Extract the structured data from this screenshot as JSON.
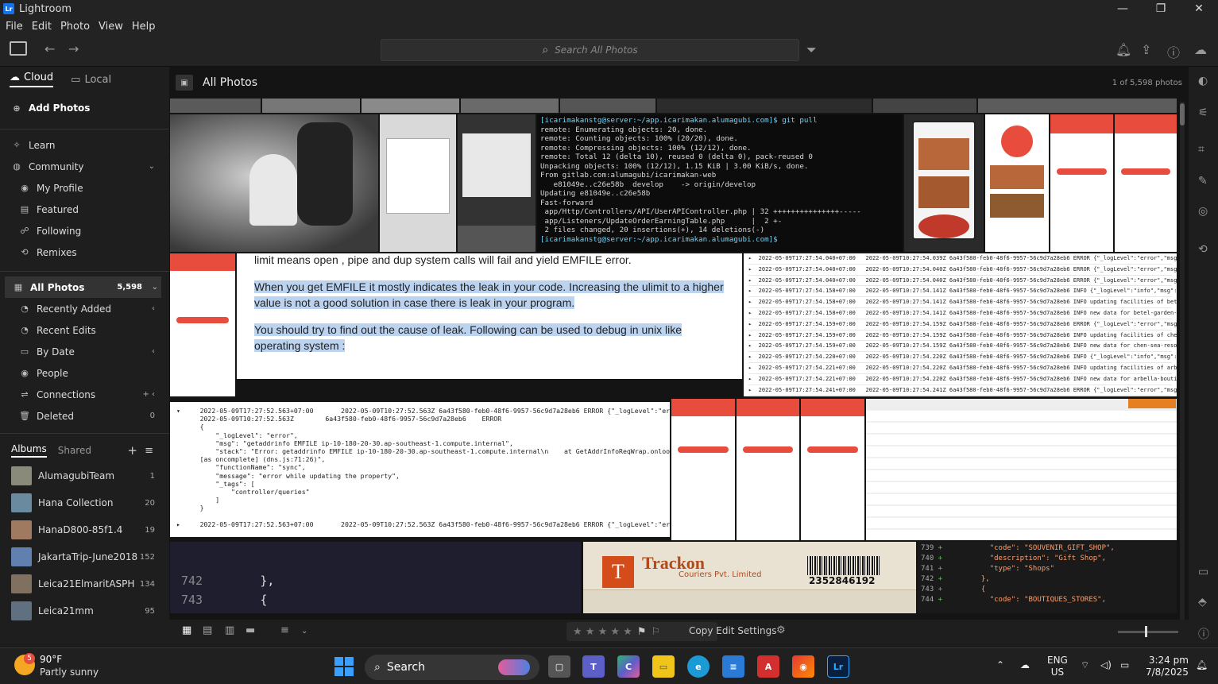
{
  "window": {
    "title": "Lightroom",
    "minimize": "—",
    "maximize": "❐",
    "close": "✕"
  },
  "menu": [
    "File",
    "Edit",
    "Photo",
    "View",
    "Help"
  ],
  "search": {
    "placeholder": "Search All Photos"
  },
  "sidebar": {
    "tabs": {
      "cloud": "Cloud",
      "local": "Local"
    },
    "add_photos": "Add Photos",
    "learn": "Learn",
    "community": {
      "label": "Community",
      "items": [
        "My Profile",
        "Featured",
        "Following",
        "Remixes"
      ]
    },
    "all_photos": {
      "label": "All Photos",
      "count": "5,598"
    },
    "library": [
      {
        "label": "Recently Added",
        "right": "‹"
      },
      {
        "label": "Recent Edits",
        "right": ""
      },
      {
        "label": "By Date",
        "right": "‹"
      },
      {
        "label": "People",
        "right": ""
      },
      {
        "label": "Connections",
        "right": "+  ‹"
      },
      {
        "label": "Deleted",
        "right": "0"
      }
    ],
    "albums_tab": "Albums",
    "shared_tab": "Shared",
    "albums": [
      {
        "name": "AlumagubiTeam",
        "count": "1",
        "color": "#8a8a7a"
      },
      {
        "name": "Hana Collection",
        "count": "20",
        "color": "#6a8aa0"
      },
      {
        "name": "HanaD800-85f1.4",
        "count": "19",
        "color": "#a07a60"
      },
      {
        "name": "JakartaTrip-June2018",
        "count": "152",
        "color": "#6080b0"
      },
      {
        "name": "Leica21ElmaritASPH",
        "count": "134",
        "color": "#807060"
      },
      {
        "name": "Leica21mm",
        "count": "95",
        "color": "#607080"
      }
    ]
  },
  "main": {
    "title": "All Photos",
    "counter": "1 of 5,598 photos"
  },
  "tiles": {
    "terminal_lines": [
      "[icarimakanstg@server:~/app.icarimakan.alumagubi.com]$ git pull",
      "remote: Enumerating objects: 20, done.",
      "remote: Counting objects: 100% (20/20), done.",
      "remote: Compressing objects: 100% (12/12), done.",
      "remote: Total 12 (delta 10), reused 0 (delta 0), pack-reused 0",
      "Unpacking objects: 100% (12/12), 1.15 KiB | 3.00 KiB/s, done.",
      "From gitlab.com:alumagubi/icarimakan-web",
      "   e81049e..c26e58b  develop    -> origin/develop",
      "Updating e81049e..c26e58b",
      "Fast-forward",
      " app/Http/Controllers/API/UserAPIController.php | 32 +++++++++++++++-----",
      " app/Listeners/UpdateOrderEarningTable.php      |  2 +-",
      " 2 files changed, 20 insertions(+), 14 deletions(-)",
      "[icarimakanstg@server:~/app.icarimakan.alumagubi.com]$ "
    ],
    "so_top": "limit means  open ,  pipe  and  dup  system calls will fail and yield EMFILE error.",
    "so_p1": "When you get  EMFILE  it mostly indicates the leak in your code. Increasing the ulimit to a higher value is not a good solution in case there is leak in your program.",
    "so_p2": "You should try to find out the cause of leak. Following can be used to debug in unix like operating system :",
    "log_rows": [
      "2022-05-09T17:27:54.040+07:00   2022-05-09T10:27:54.039Z 6a43f580-feb0-48f6-9957-56c9d7a28eb6 ERROR {\"_logLevel\":\"error\",\"msg\":\"connect",
      "2022-05-09T17:27:54.040+07:00   2022-05-09T10:27:54.040Z 6a43f580-feb0-48f6-9957-56c9d7a28eb6 ERROR {\"_logLevel\":\"error\",\"msg\":\"connect",
      "2022-05-09T17:27:54.040+07:00   2022-05-09T10:27:54.040Z 6a43f580-feb0-48f6-9957-56c9d7a28eb6 ERROR {\"_logLevel\":\"error\",\"msg\":\"connect",
      "2022-05-09T17:27:54.158+07:00   2022-05-09T10:27:54.141Z 6a43f580-feb0-48f6-9957-56c9d7a28eb6 INFO {\"_logLevel\":\"info\",\"msg\":\"property -",
      "2022-05-09T17:27:54.158+07:00   2022-05-09T10:27:54.141Z 6a43f580-feb0-48f6-9957-56c9d7a28eb6 INFO updating facilities of betel-garden-",
      "2022-05-09T17:27:54.158+07:00   2022-05-09T10:27:54.141Z 6a43f580-feb0-48f6-9957-56c9d7a28eb6 INFO new data for betel-garden-villas-hoi",
      "2022-05-09T17:27:54.159+07:00   2022-05-09T10:27:54.159Z 6a43f580-feb0-48f6-9957-56c9d7a28eb6 ERROR {\"_logLevel\":\"error\",\"msg\":\"connect",
      "2022-05-09T17:27:54.159+07:00   2022-05-09T10:27:54.159Z 6a43f580-feb0-48f6-9957-56c9d7a28eb6 INFO updating facilities of chen-sea-reso",
      "2022-05-09T17:27:54.159+07:00   2022-05-09T10:27:54.159Z 6a43f580-feb0-48f6-9957-56c9d7a28eb6 INFO new data for chen-sea-resort-spa-phu",
      "2022-05-09T17:27:54.220+07:00   2022-05-09T10:27:54.220Z 6a43f580-feb0-48f6-9957-56c9d7a28eb6 INFO {\"_logLevel\":\"info\",\"msg\":\"property -",
      "2022-05-09T17:27:54.221+07:00   2022-05-09T10:27:54.220Z 6a43f580-feb0-48f6-9957-56c9d7a28eb6 INFO updating facilities of arbella-bouti",
      "2022-05-09T17:27:54.221+07:00   2022-05-09T10:27:54.220Z 6a43f580-feb0-48f6-9957-56c9d7a28eb6 INFO new data for arbella-boutique-hotel-",
      "2022-05-09T17:27:54.241+07:00   2022-05-09T10:27:54.241Z 6a43f580-feb0-48f6-9957-56c9d7a28eb6 ERROR {\"_logLevel\":\"error\",\"msg\":\"connect",
      "2022-05-09T17:27:54.241+07:00   2022-05-09T10:27:54.241Z 6a43f580-feb0-48f6-9957-56c9d7a28eb6 ERROR {\"_logLevel\":\"error\",\"msg\":\"connect"
    ],
    "log_detail": "▾     2022-05-09T17:27:52.563+07:00       2022-05-09T10:27:52.563Z 6a43f580-feb0-48f6-9957-56c9d7a28eb6 ERROR {\"_logLevel\":\"error\",\"msg\":\"g\n      2022-05-09T10:27:52.563Z        6a43f580-feb0-48f6-9957-56c9d7a28eb6    ERROR\n      {\n          \"_logLevel\": \"error\",\n          \"msg\": \"getaddrinfo EMFILE ip-10-180-20-30.ap-southeast-1.compute.internal\",\n          \"stack\": \"Error: getaddrinfo EMFILE ip-10-180-20-30.ap-southeast-1.compute.internal\\n    at GetAddrInfoReqWrap.onlookup\n      [as oncomplete] (dns.js:71:26)\",\n          \"functionName\": \"sync\",\n          \"message\": \"error while updating the property\",\n          \"_tags\": [\n              \"controller/queries\"\n          ]\n      }\n\n▸     2022-05-09T17:27:52.563+07:00       2022-05-09T10:27:52.563Z 6a43f580-feb0-48f6-9957-56c9d7a28eb6 ERROR {\"_logLevel\":\"error\",\"msg\":\"g",
    "code_lines": [
      {
        "num": "742",
        "text": "        },"
      },
      {
        "num": "743",
        "text": "        {"
      }
    ],
    "code2_lines": [
      {
        "num": "739",
        "text": "          \"code\": \"SOUVENIR_GIFT_SHOP\","
      },
      {
        "num": "740",
        "text": "          \"description\": \"Gift Shop\","
      },
      {
        "num": "741",
        "text": "          \"type\": \"Shops\""
      },
      {
        "num": "742",
        "text": "        },"
      },
      {
        "num": "743",
        "text": "        {"
      },
      {
        "num": "744",
        "text": "          \"code\": \"BOUTIQUES_STORES\","
      }
    ],
    "trackon": {
      "brand": "Trackon",
      "sub": "Couriers Pvt. Limited",
      "barcode": "2352846192"
    }
  },
  "bottombar": {
    "copy_edit": "Copy Edit Settings",
    "stars": "★ ★ ★ ★ ★"
  },
  "taskbar": {
    "weather_temp": "90°F",
    "weather_desc": "Partly sunny",
    "weather_badge": "5",
    "search": "Search",
    "lang1": "ENG",
    "lang2": "US",
    "time": "3:24 pm",
    "date": "7/8/2025"
  }
}
